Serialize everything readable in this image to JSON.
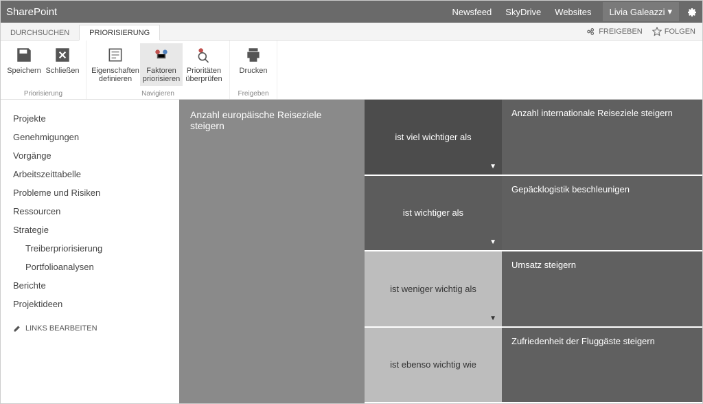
{
  "suite": {
    "title": "SharePoint",
    "links": [
      "Newsfeed",
      "SkyDrive",
      "Websites"
    ],
    "user": "Livia Galeazzi"
  },
  "tabs": {
    "items": [
      "DURCHSUCHEN",
      "PRIORISIERUNG"
    ],
    "active": 1,
    "share": "FREIGEBEN",
    "follow": "FOLGEN"
  },
  "ribbon": {
    "groups": [
      {
        "label": "Priorisierung",
        "buttons": [
          {
            "label": "Speichern",
            "icon": "save-icon"
          },
          {
            "label": "Schließen",
            "icon": "close-icon"
          }
        ]
      },
      {
        "label": "Navigieren",
        "buttons": [
          {
            "label": "Eigenschaften definieren",
            "icon": "properties-icon"
          },
          {
            "label": "Faktoren priorisieren",
            "icon": "factors-icon",
            "active": true
          },
          {
            "label": "Prioritäten überprüfen",
            "icon": "review-icon"
          }
        ]
      },
      {
        "label": "Freigeben",
        "buttons": [
          {
            "label": "Drucken",
            "icon": "print-icon"
          }
        ]
      }
    ]
  },
  "sidebar": {
    "items": [
      {
        "label": "Projekte"
      },
      {
        "label": "Genehmigungen"
      },
      {
        "label": "Vorgänge"
      },
      {
        "label": "Arbeitszeittabelle"
      },
      {
        "label": "Probleme und Risiken"
      },
      {
        "label": "Ressourcen"
      },
      {
        "label": "Strategie"
      },
      {
        "label": "Treiberpriorisierung",
        "sub": true
      },
      {
        "label": "Portfolioanalysen",
        "sub": true
      },
      {
        "label": "Berichte"
      },
      {
        "label": "Projektideen"
      }
    ],
    "edit": "LINKS BEARBEITEN"
  },
  "matrix": {
    "leftHeader": "Anzahl europäische Reiseziele steigern",
    "rows": [
      {
        "relation": "ist viel wichtiger als",
        "right": "Anzahl internationale Reiseziele steigern",
        "midClass": "dark1",
        "arrow": true
      },
      {
        "relation": "ist wichtiger als",
        "right": "Gepäcklogistik beschleunigen",
        "midClass": "dark2",
        "arrow": true
      },
      {
        "relation": "ist weniger wichtig als",
        "right": "Umsatz steigern",
        "midClass": "light1",
        "arrow": true
      },
      {
        "relation": "ist ebenso wichtig wie",
        "right": "Zufriedenheit der Fluggäste steigern",
        "midClass": "light2",
        "arrow": false
      }
    ]
  }
}
